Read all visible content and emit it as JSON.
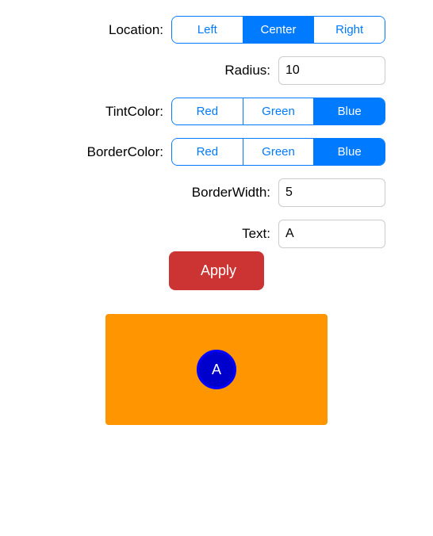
{
  "form": {
    "location_label": "Location:",
    "radius_label": "Radius:",
    "tint_color_label": "TintColor:",
    "border_color_label": "BorderColor:",
    "border_width_label": "BorderWidth:",
    "text_label": "Text:",
    "apply_label": "Apply",
    "radius_value": "10",
    "border_width_value": "5",
    "text_value": "A",
    "location_options": [
      "Left",
      "Center",
      "Right"
    ],
    "location_active": "Center",
    "tint_options": [
      "Red",
      "Green",
      "Blue"
    ],
    "tint_active": "Blue",
    "border_options": [
      "Red",
      "Green",
      "Blue"
    ],
    "border_active": "Blue"
  },
  "preview": {
    "badge_text": "A",
    "background_color": "#FF9500",
    "badge_color": "#0000CC",
    "border_color": "#0000FF"
  }
}
